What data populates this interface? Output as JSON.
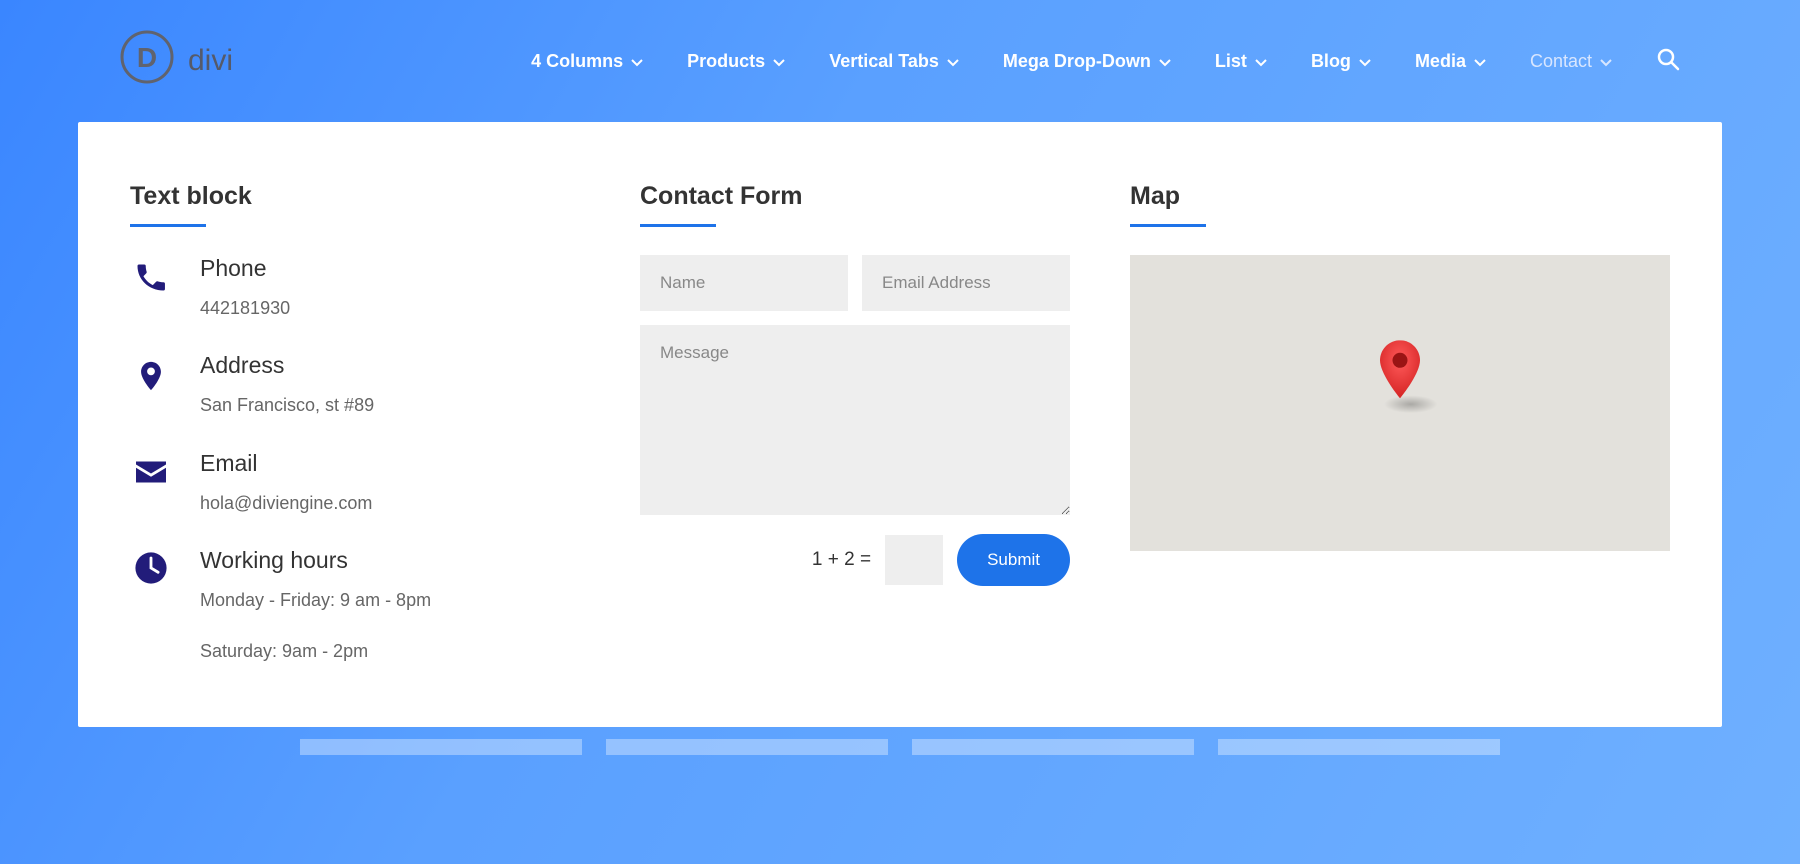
{
  "logo_text": "divi",
  "nav": {
    "items": [
      {
        "label": "4 Columns",
        "active": true
      },
      {
        "label": "Products",
        "active": true
      },
      {
        "label": "Vertical Tabs",
        "active": true
      },
      {
        "label": "Mega Drop-Down",
        "active": true
      },
      {
        "label": "List",
        "active": true
      },
      {
        "label": "Blog",
        "active": true
      },
      {
        "label": "Media",
        "active": true
      },
      {
        "label": "Contact",
        "active": false
      }
    ]
  },
  "textblock": {
    "title": "Text block",
    "phone": {
      "title": "Phone",
      "value": "442181930"
    },
    "address": {
      "title": "Address",
      "value": "San Francisco, st #89"
    },
    "email": {
      "title": "Email",
      "value": "hola@diviengine.com"
    },
    "hours": {
      "title": "Working hours",
      "line1": "Monday - Friday: 9 am - 8pm",
      "line2": "Saturday: 9am - 2pm"
    }
  },
  "contact": {
    "title": "Contact Form",
    "name_placeholder": "Name",
    "email_placeholder": "Email Address",
    "message_placeholder": "Message",
    "captcha_question": "1 + 2 =",
    "submit_label": "Submit"
  },
  "map": {
    "title": "Map"
  }
}
